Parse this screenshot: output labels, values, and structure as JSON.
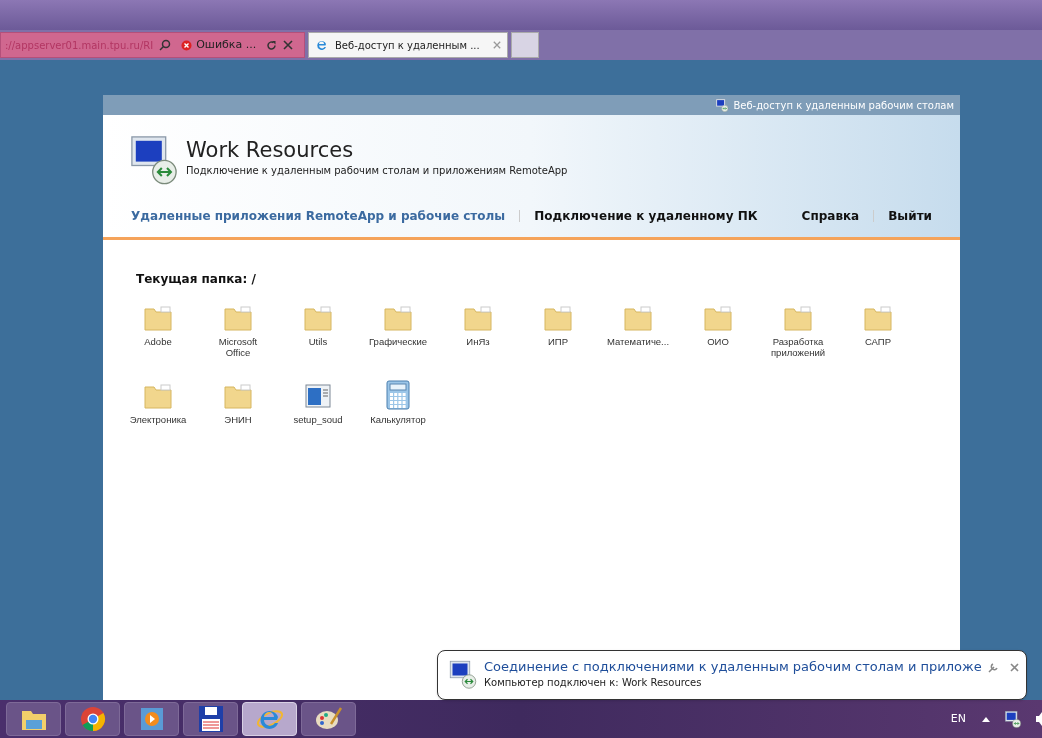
{
  "browser": {
    "address": "://appserver01.main.tpu.ru/RI",
    "tabs": [
      {
        "title": "Ошибка ...",
        "kind": "error",
        "selected": false
      },
      {
        "title": "Веб-доступ к удаленным ...",
        "kind": "ie",
        "selected": true
      }
    ]
  },
  "page": {
    "top_bar_title": "Веб-доступ к удаленным рабочим столам",
    "title": "Work Resources",
    "subtitle": "Подключение к удаленным рабочим столам и приложениям RemoteApp",
    "nav": [
      {
        "label": "Удаленные приложения RemoteApp и рабочие столы",
        "selected": true
      },
      {
        "label": "Подключение к удаленному ПК",
        "selected": false
      }
    ],
    "nav_right": [
      "Справка",
      "Выйти"
    ],
    "current_folder": "Текущая папка: /",
    "items": [
      {
        "label": "Adobe",
        "kind": "folder"
      },
      {
        "label": "Microsoft Office",
        "kind": "folder"
      },
      {
        "label": "Utils",
        "kind": "folder"
      },
      {
        "label": "Графические",
        "kind": "folder"
      },
      {
        "label": "ИнЯз",
        "kind": "folder"
      },
      {
        "label": "ИПР",
        "kind": "folder"
      },
      {
        "label": "Математиче...",
        "kind": "folder"
      },
      {
        "label": "ОИО",
        "kind": "folder"
      },
      {
        "label": "Разработка приложений",
        "kind": "folder"
      },
      {
        "label": "САПР",
        "kind": "folder"
      },
      {
        "label": "Электроника",
        "kind": "folder"
      },
      {
        "label": "ЭНИН",
        "kind": "folder"
      },
      {
        "label": "setup_soud",
        "kind": "app"
      },
      {
        "label": "Калькулятор",
        "kind": "calculator"
      }
    ]
  },
  "notification": {
    "title": "Соединение с подключениями к удаленным рабочим столам и приложе",
    "message": "Компьютер подключен к: Work Resources"
  },
  "taskbar": {
    "apps": [
      {
        "kind": "explorer",
        "active": false
      },
      {
        "kind": "chrome",
        "active": false
      },
      {
        "kind": "player",
        "active": false
      },
      {
        "kind": "save",
        "active": false
      },
      {
        "kind": "ie",
        "active": true
      },
      {
        "kind": "paint",
        "active": false
      }
    ],
    "language": "EN"
  }
}
